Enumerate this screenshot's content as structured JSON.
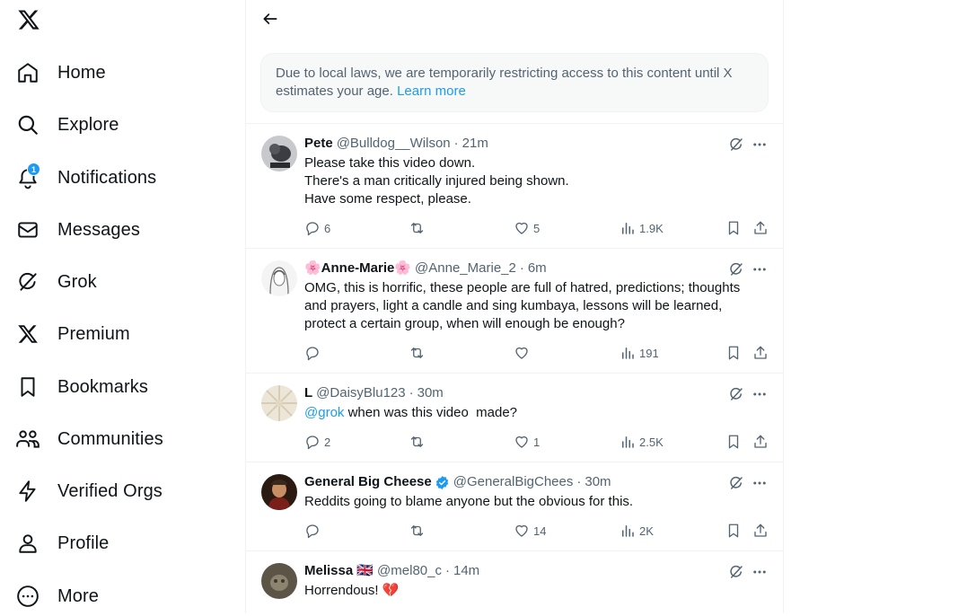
{
  "nav": {
    "items": [
      {
        "label": "Home",
        "icon": "home-icon"
      },
      {
        "label": "Explore",
        "icon": "search-icon"
      },
      {
        "label": "Notifications",
        "icon": "bell-icon",
        "badge": "1"
      },
      {
        "label": "Messages",
        "icon": "envelope-icon"
      },
      {
        "label": "Grok",
        "icon": "grok-icon"
      },
      {
        "label": "Premium",
        "icon": "x-logo-icon"
      },
      {
        "label": "Bookmarks",
        "icon": "bookmark-icon"
      },
      {
        "label": "Communities",
        "icon": "communities-icon"
      },
      {
        "label": "Verified Orgs",
        "icon": "lightning-icon"
      },
      {
        "label": "Profile",
        "icon": "person-icon"
      },
      {
        "label": "More",
        "icon": "more-circle-icon"
      }
    ]
  },
  "notice": {
    "text": "Due to local laws, we are temporarily restricting access to this content until X estimates your age. ",
    "link": "Learn more"
  },
  "colors": {
    "accent": "#1d9bf0",
    "text_primary": "#0f1419",
    "text_secondary": "#536471"
  },
  "tweets": [
    {
      "name": "Pete",
      "handle": "@Bulldog__Wilson",
      "time": "21m",
      "body": "Please take this video down.\nThere's a man critically injured being shown.\nHave some respect, please.",
      "replies": "6",
      "retweets": "",
      "likes": "5",
      "views": "1.9K"
    },
    {
      "name": "🌸Anne-Marie🌸",
      "handle": "@Anne_Marie_2",
      "time": "6m",
      "body": "OMG, this is horrific, these people are full of hatred, predictions; thoughts and prayers, light a candle and sing kumbaya, lessons will be learned, protect a certain group, when will enough be enough?",
      "replies": "",
      "retweets": "",
      "likes": "",
      "views": "191"
    },
    {
      "name": "L",
      "handle": "@DaisyBlu123",
      "time": "30m",
      "mention": "@grok",
      "body": " when was this video  made?",
      "replies": "2",
      "retweets": "",
      "likes": "1",
      "views": "2.5K"
    },
    {
      "name": "General Big Cheese",
      "handle": "@GeneralBigChees",
      "time": "30m",
      "verified": true,
      "body": "Reddits going to blame anyone but the obvious for this.",
      "replies": "",
      "retweets": "",
      "likes": "14",
      "views": "2K"
    },
    {
      "name": "Melissa 🇬🇧",
      "handle": "@mel80_c",
      "time": "14m",
      "body": "Horrendous! 💔",
      "replies": "",
      "retweets": "",
      "likes": "",
      "views": ""
    }
  ]
}
